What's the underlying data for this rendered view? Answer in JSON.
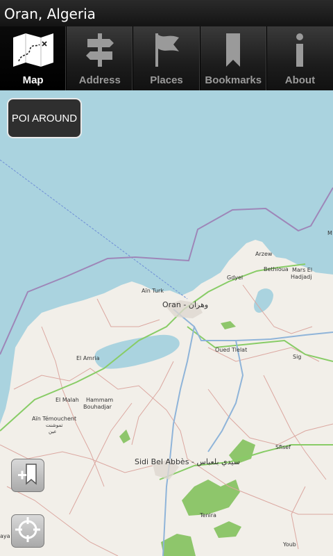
{
  "title": "Oran, Algeria",
  "tabs": [
    {
      "label": "Map",
      "icon": "map-icon",
      "active": true
    },
    {
      "label": "Address",
      "icon": "signpost-icon",
      "active": false
    },
    {
      "label": "Places",
      "icon": "flag-icon",
      "active": false
    },
    {
      "label": "Bookmarks",
      "icon": "bookmark-icon",
      "active": false
    },
    {
      "label": "About",
      "icon": "info-icon",
      "active": false
    }
  ],
  "poi_button": "POI AROUND",
  "map_labels": {
    "arzew": "Arzew",
    "bethioua": "Bethioua",
    "mars_el_hadjadj_1": "Mars El",
    "mars_el_hadjadj_2": "Hadjadj",
    "gdyel": "Gdyel",
    "ain_turk": "Aïn Turk",
    "oran": "Oran - وهران",
    "oued_tlelat": "Oued Tlelat",
    "sig": "Sig",
    "el_amria": "El Amria",
    "el_malah": "El Malah",
    "hammam_1": "Hammam",
    "hammam_2": "Bouhadjar",
    "ain_temouchent_1": "Aïn Témouchent",
    "ain_temouchent_2": "تموشنت",
    "ain_temouchent_3": "عين",
    "sfisef": "Sfisef",
    "sidi_bel_abbes": "Sidi Bel Abbès - سيدي بلعباس",
    "tenira": "Tenira",
    "youb": "Youb",
    "edge_m": "M",
    "edge_aya": "aya"
  },
  "colors": {
    "sea": "#aad3df",
    "land": "#f2efe9",
    "border": "#9e86b8",
    "road_main": "#8fb4d9",
    "road_green": "#88cc66",
    "road_red": "#d9a3a3",
    "forest": "#8ec66b"
  }
}
